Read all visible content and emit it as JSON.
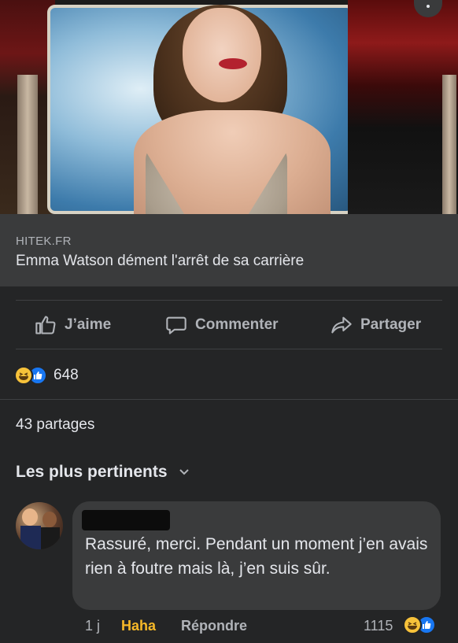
{
  "post": {
    "link_source": "HITEK.FR",
    "link_title": "Emma Watson dément l'arrêt de sa carrière"
  },
  "actions": {
    "like_label": "J’aime",
    "comment_label": "Commenter",
    "share_label": "Partager"
  },
  "reactions": {
    "icons": [
      "haha-icon",
      "like-icon"
    ],
    "count": "648"
  },
  "shares_text": "43 partages",
  "sort": {
    "label": "Les plus pertinents"
  },
  "comment": {
    "text": "Rassuré, merci. Pendant un moment j’en avais rien à foutre mais là, j’en suis sûr.",
    "time": "1 j",
    "reaction_button": "Haha",
    "reply_label": "Répondre",
    "reaction_count": "1115"
  },
  "colors": {
    "background": "#242526",
    "surface": "#3a3b3c",
    "haha_accent": "#f7b928",
    "like_blue": "#1877f2"
  }
}
